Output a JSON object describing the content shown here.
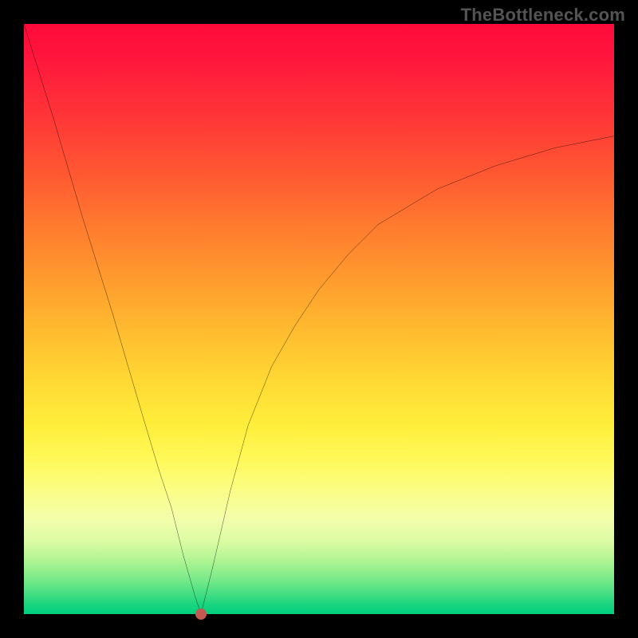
{
  "watermark": "TheBottleneck.com",
  "colors": {
    "background": "#000000",
    "curve_stroke": "#000000",
    "dot": "#c35a51",
    "gradient_top": "#ff0a3a",
    "gradient_bottom": "#00cf7e"
  },
  "chart_data": {
    "type": "line",
    "title": "",
    "xlabel": "",
    "ylabel": "",
    "xlim": [
      0,
      100
    ],
    "ylim": [
      0,
      100
    ],
    "series": [
      {
        "name": "bottleneck-curve",
        "x": [
          0,
          5,
          10,
          15,
          20,
          23,
          25,
          27,
          29,
          30,
          32,
          35,
          38,
          42,
          46,
          50,
          55,
          60,
          65,
          70,
          75,
          80,
          85,
          90,
          95,
          100
        ],
        "y": [
          100,
          84,
          67,
          51,
          34,
          24,
          18,
          10,
          3,
          0,
          8,
          21,
          32,
          42,
          49,
          55,
          61,
          66,
          69,
          72,
          74,
          76,
          77.5,
          79,
          80,
          81
        ]
      }
    ],
    "marker": {
      "name": "optimal-point",
      "x": 30,
      "y": 0
    },
    "gradient_meaning": "top (red) = severe bottleneck, bottom (green) = balanced",
    "grid": false,
    "legend": false
  }
}
